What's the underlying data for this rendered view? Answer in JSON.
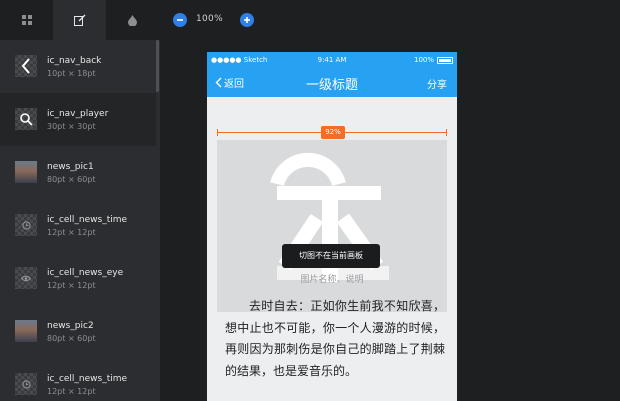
{
  "toolbar": {
    "tabs": [
      {
        "icon": "grid-icon"
      },
      {
        "icon": "edit-icon"
      },
      {
        "icon": "drop-icon"
      }
    ],
    "zoom_level": "100%",
    "zoom_out_icon": "minus-icon",
    "zoom_in_icon": "plus-icon",
    "accent": "#2f7fe6"
  },
  "sidebar": {
    "slices": [
      {
        "name": "ic_nav_back",
        "size": "10pt × 18pt",
        "thumb": "back-arrow-icon"
      },
      {
        "name": "ic_nav_player",
        "size": "30pt × 30pt",
        "thumb": "search-icon"
      },
      {
        "name": "news_pic1",
        "size": "80pt × 60pt",
        "thumb": "photo"
      },
      {
        "name": "ic_cell_news_time",
        "size": "12pt × 12pt",
        "thumb": "clock-icon"
      },
      {
        "name": "ic_cell_news_eye",
        "size": "12pt × 12pt",
        "thumb": "eye-icon"
      },
      {
        "name": "news_pic2",
        "size": "80pt × 60pt",
        "thumb": "photo"
      },
      {
        "name": "ic_cell_news_time",
        "size": "12pt × 12pt",
        "thumb": "clock-icon"
      }
    ]
  },
  "phone": {
    "status": {
      "carrier": "●●●●● Sketch",
      "time": "9:41 AM",
      "battery": "100%"
    },
    "nav": {
      "back": "返回",
      "title": "一级标题",
      "share": "分享"
    },
    "measure_percent": "92%",
    "tooltip": "切图不在当前画板",
    "caption": "图片名称、说明",
    "article": "去时自去：正如你生前我不知欣喜，想中止也不可能，你一个人漫游的时候，再则因为那刺伤是你自己的脚踏上了荆棘的结果，也是爱音乐的。",
    "colors": {
      "nav": "#27a1f1",
      "measure": "#f36c2a"
    }
  }
}
